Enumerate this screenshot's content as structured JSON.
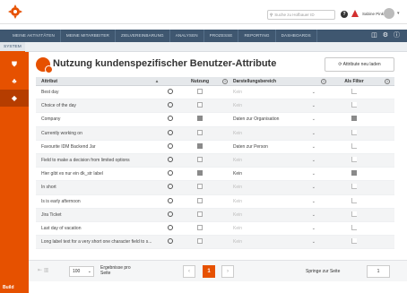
{
  "header": {
    "search_placeholder": "Suche zu Hofbauer ID",
    "user_name": "Sabine Pink",
    "help_icon": "question-icon",
    "warning_icon": "warning-icon"
  },
  "nav": {
    "items": [
      "MEINE AKTIVITÄTEN",
      "MEINE MITARBEITER",
      "ZIELVEREINBARUNG",
      "ANALYSEN",
      "PROZESSE",
      "REPORTING",
      "DASHBOARDS"
    ]
  },
  "subnav": {
    "active_tab": "SYSTEM"
  },
  "sidebar": {
    "build_label": "Build"
  },
  "page": {
    "title": "Nutzung kundenspezifischer Benutzer-Attribute",
    "reload_label": "Attribute neu laden"
  },
  "table": {
    "headers": {
      "attribute": "Attribut",
      "usage": "Nutzung",
      "area": "Darstellungsbereich",
      "filter": "Als Filter"
    },
    "placeholder": "Kein",
    "rows": [
      {
        "name": "Best day",
        "usage": false,
        "area": "",
        "filter": false
      },
      {
        "name": "Choice of the day",
        "usage": false,
        "area": "",
        "filter": false
      },
      {
        "name": "Company",
        "usage": true,
        "area": "Daten zur Organisation",
        "filter": true
      },
      {
        "name": "Currently working on",
        "usage": false,
        "area": "",
        "filter": false
      },
      {
        "name": "Favourite IDM Backend Jar",
        "usage": true,
        "area": "Daten zur Person",
        "filter": false
      },
      {
        "name": "Field to make a decision from limited options",
        "usage": false,
        "area": "",
        "filter": false
      },
      {
        "name": "Hier gibt es nur ein dk_str label",
        "usage": true,
        "area": "Kein",
        "filter": true
      },
      {
        "name": "In short",
        "usage": false,
        "area": "",
        "filter": false
      },
      {
        "name": "Is is early afternoon",
        "usage": false,
        "area": "",
        "filter": false
      },
      {
        "name": "Jira Ticket",
        "usage": false,
        "area": "",
        "filter": false
      },
      {
        "name": "Last day of vacation",
        "usage": false,
        "area": "",
        "filter": false
      },
      {
        "name": "Long label text for a very short one character field to s...",
        "usage": false,
        "area": "",
        "filter": false
      }
    ]
  },
  "footer": {
    "per_page_value": "100",
    "per_page_label": "Ergebnisse pro Seite",
    "current_page": "1",
    "goto_label": "Springe zur Seite",
    "goto_value": "1"
  },
  "colors": {
    "accent": "#e65100",
    "nav": "#3f5770",
    "danger": "#d32f2f"
  }
}
